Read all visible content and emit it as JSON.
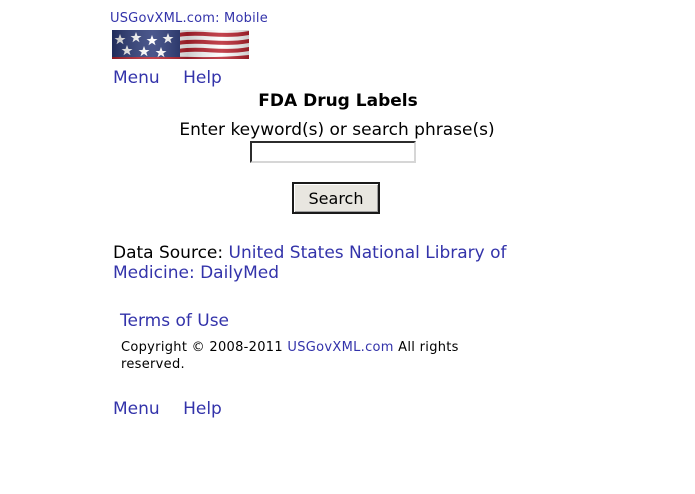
{
  "header": {
    "site_title": "USGovXML.com: Mobile",
    "flag_colors": {
      "canton": "#2b3a78",
      "red": "#b8232f",
      "white": "#ffffff"
    }
  },
  "nav": {
    "menu_label": "Menu",
    "help_label": "Help"
  },
  "main": {
    "title": "FDA Drug Labels",
    "search_label": "Enter keyword(s) or search phrase(s)",
    "search_value": "",
    "search_placeholder": "",
    "search_button_label": "Search"
  },
  "data_source": {
    "prefix": "Data Source: ",
    "link_text": "United States National Library of Medicine: DailyMed"
  },
  "footer": {
    "terms_label": "Terms of Use",
    "copyright_prefix": "Copyright © 2008-2011 ",
    "copyright_link": "USGovXML.com",
    "copyright_suffix": " All rights reserved."
  },
  "colors": {
    "link": "#3333aa",
    "text": "#000000",
    "background": "#ffffff"
  }
}
